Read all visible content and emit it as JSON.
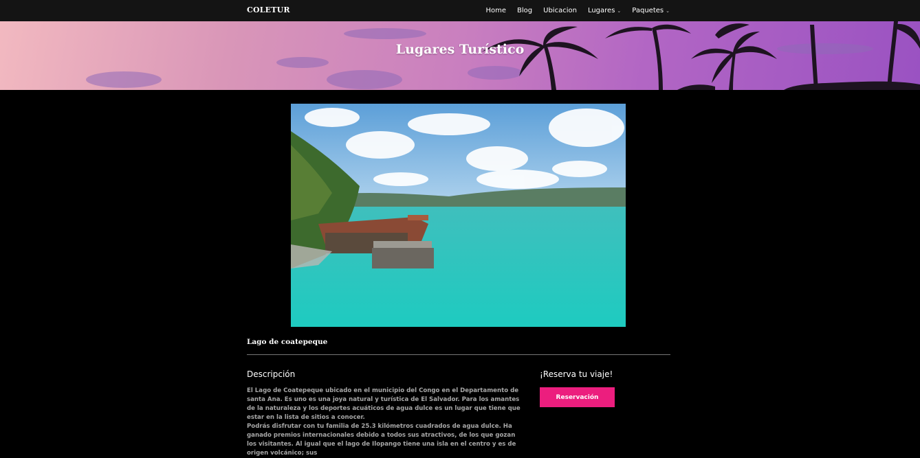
{
  "navbar": {
    "brand": "COLETUR",
    "items": [
      {
        "label": "Home"
      },
      {
        "label": "Blog"
      },
      {
        "label": "Ubicacion"
      },
      {
        "label": "Lugares",
        "dropdown": true
      },
      {
        "label": "Paquetes",
        "dropdown": true
      }
    ]
  },
  "hero": {
    "title": "Lugares Turístico"
  },
  "place": {
    "name": "Lago de coatepeque"
  },
  "description": {
    "title": "Descripción",
    "paragraph1": "El Lago de Coatepeque ubicado en el municipio del Congo en el Departamento de santa Ana. Es uno es una joya natural y turística de El Salvador. Para los amantes de la naturaleza y los deportes acuáticos de agua dulce es un lugar que tiene que estar en la lista de sitios a conocer.",
    "paragraph2": "Podrás disfrutar con tu familia de 25.3 kilómetros cuadrados de agua dulce. Ha ganado premios internacionales debido a todos sus atractivos, de los que gozan los visitantes. Al igual que el lago de Ilopango tiene una isla en el centro y es de origen volcánico; sus"
  },
  "reserve": {
    "title": "¡Reserva tu viaje!",
    "button_label": "Reservación"
  },
  "colors": {
    "accent": "#ec1e7e",
    "navbar_bg": "#141414",
    "page_bg": "#000000"
  }
}
